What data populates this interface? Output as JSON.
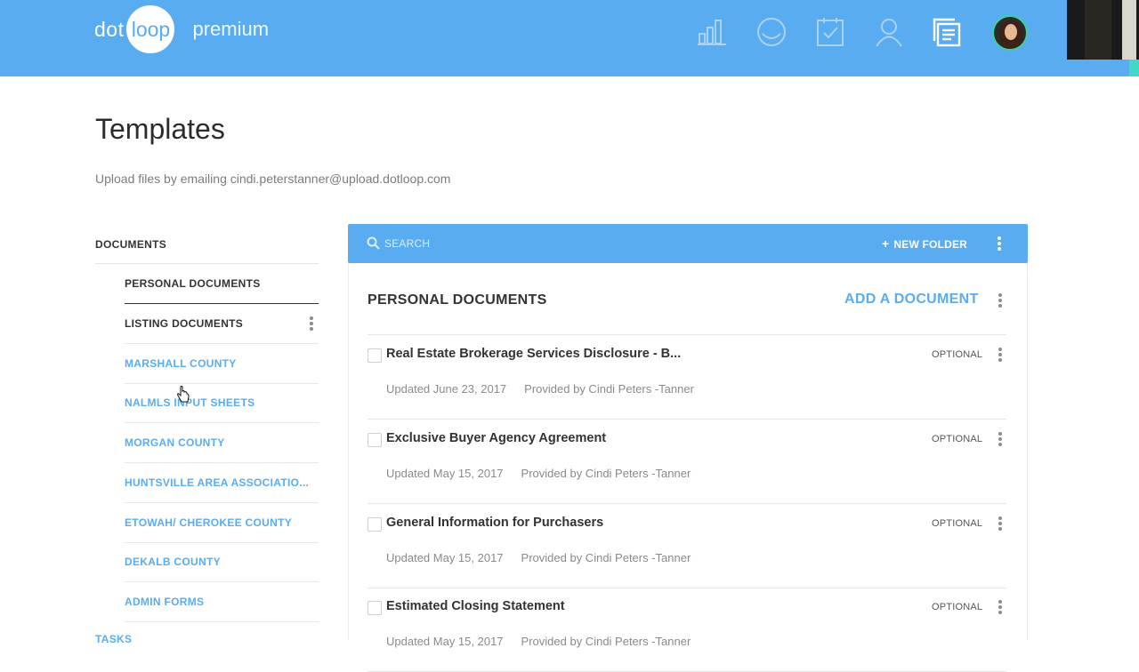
{
  "header": {
    "logo_dot": "dot",
    "logo_loop": "loop",
    "logo_premium": "premium",
    "icons": [
      "bar-chart-icon",
      "loop-circle-icon",
      "task-checklist-icon",
      "profile-icon",
      "documents-icon"
    ],
    "accent_color": "#5aacf0"
  },
  "page": {
    "title": "Templates",
    "upload_note": "Upload files by emailing cindi.peterstanner@upload.dotloop.com"
  },
  "sidebar": {
    "header": "DOCUMENTS",
    "items": [
      {
        "label": "PERSONAL DOCUMENTS"
      },
      {
        "label": "LISTING DOCUMENTS"
      },
      {
        "label": "MARSHALL COUNTY"
      },
      {
        "label": "NALMLS INPUT SHEETS"
      },
      {
        "label": "MORGAN COUNTY"
      },
      {
        "label": "HUNTSVILLE AREA ASSOCIATIO..."
      },
      {
        "label": "ETOWAH/ CHEROKEE COUNTY"
      },
      {
        "label": "DEKALB COUNTY"
      },
      {
        "label": "ADMIN FORMS"
      }
    ],
    "cut_off_label": "TASKS"
  },
  "toolbar": {
    "search_label": "SEARCH",
    "new_folder_label": "NEW FOLDER"
  },
  "panel": {
    "title": "PERSONAL DOCUMENTS",
    "add_document_label": "ADD A DOCUMENT",
    "documents": [
      {
        "name": "Real Estate Brokerage Services Disclosure - B...",
        "status": "OPTIONAL",
        "updated": "Updated June 23, 2017",
        "provided": "Provided by Cindi Peters -Tanner"
      },
      {
        "name": "Exclusive Buyer Agency Agreement",
        "status": "OPTIONAL",
        "updated": "Updated May 15, 2017",
        "provided": "Provided by Cindi Peters -Tanner"
      },
      {
        "name": "General Information for Purchasers",
        "status": "OPTIONAL",
        "updated": "Updated May 15, 2017",
        "provided": "Provided by Cindi Peters -Tanner"
      },
      {
        "name": "Estimated Closing Statement",
        "status": "OPTIONAL",
        "updated": "Updated May 15, 2017",
        "provided": "Provided by Cindi Peters -Tanner"
      }
    ]
  }
}
